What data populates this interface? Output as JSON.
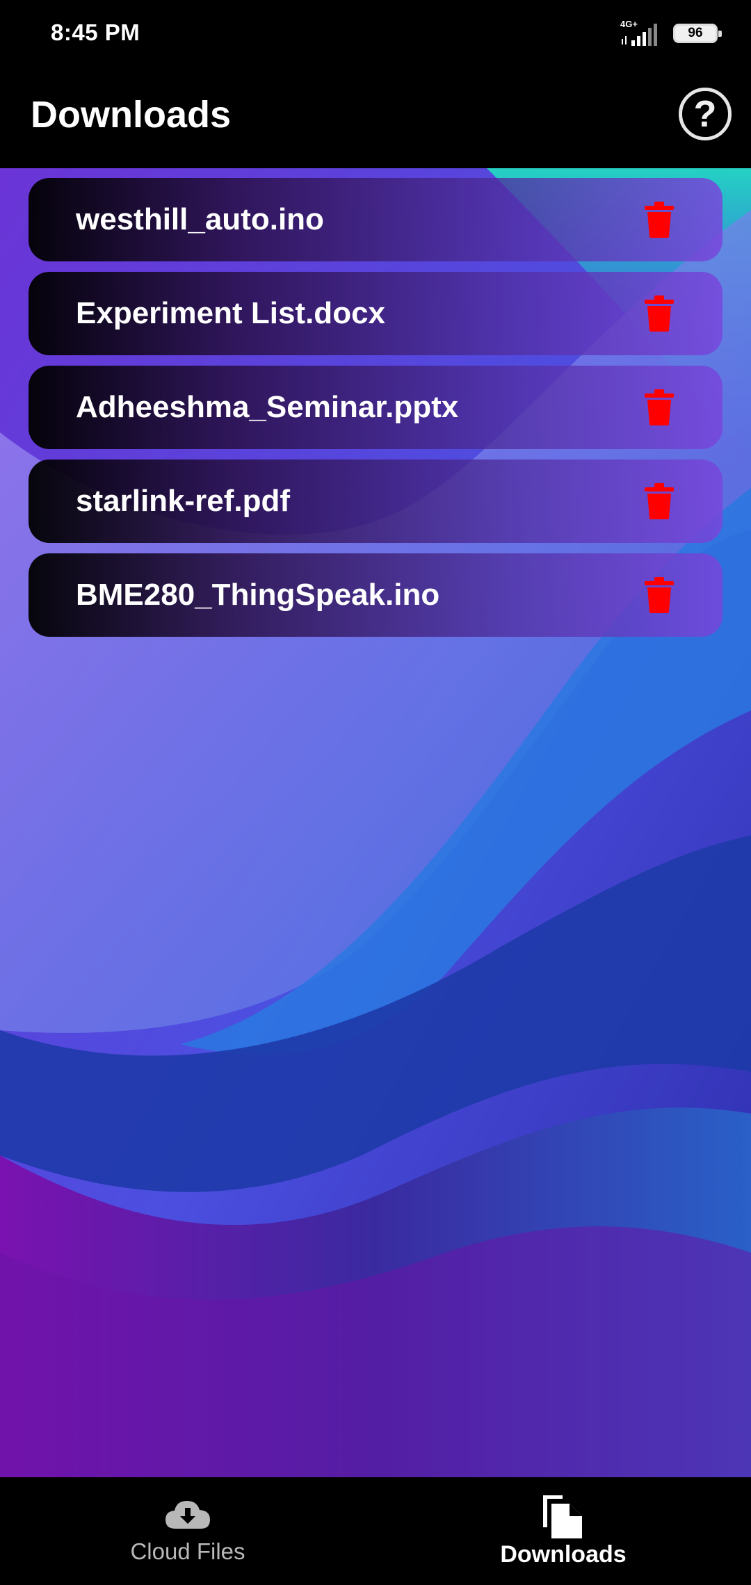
{
  "status_bar": {
    "time": "8:45 PM",
    "network": "4G+",
    "battery": "96"
  },
  "app_bar": {
    "title": "Downloads",
    "help_icon": "help-circle-icon"
  },
  "files": [
    {
      "name": "westhill_auto.ino"
    },
    {
      "name": "Experiment List.docx"
    },
    {
      "name": "Adheeshma_Seminar.pptx"
    },
    {
      "name": "starlink-ref.pdf"
    },
    {
      "name": "BME280_ThingSpeak.ino"
    }
  ],
  "delete_icon": "trash-icon",
  "colors": {
    "delete": "#ff0000",
    "nav_active": "#ffffff",
    "nav_inactive": "#b8b8b8"
  },
  "bottom_nav": {
    "items": [
      {
        "label": "Cloud Files",
        "icon": "cloud-download-icon",
        "active": false
      },
      {
        "label": "Downloads",
        "icon": "files-icon",
        "active": true
      }
    ]
  }
}
